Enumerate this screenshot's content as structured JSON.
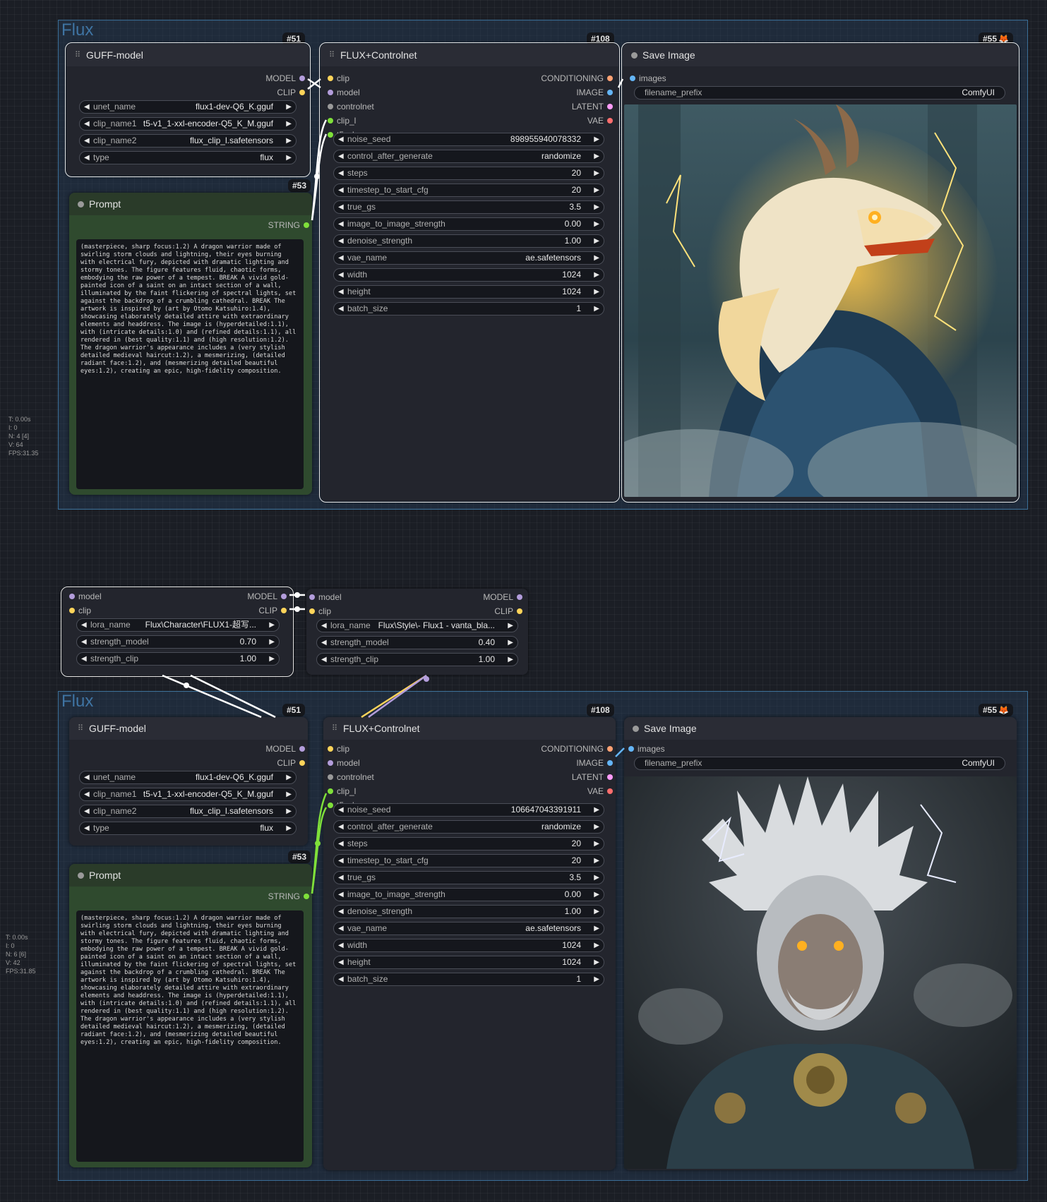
{
  "stats_top": [
    "T: 0.00s",
    "I: 0",
    "N: 4 [4]",
    "V: 64",
    "FPS:31.35"
  ],
  "stats_bottom": [
    "T: 0.00s",
    "I: 0",
    "N: 6 [6]",
    "V: 42",
    "FPS:31.85"
  ],
  "group_title": "Flux",
  "guff": {
    "badge": "#51",
    "title": "GUFF-model",
    "out_model": "MODEL",
    "out_clip": "CLIP",
    "widgets": [
      {
        "name": "unet_name",
        "value": "flux1-dev-Q6_K.gguf"
      },
      {
        "name": "clip_name1",
        "value": "t5-v1_1-xxl-encoder-Q5_K_M.gguf"
      },
      {
        "name": "clip_name2",
        "value": "flux_clip_l.safetensors"
      },
      {
        "name": "type",
        "value": "flux"
      }
    ]
  },
  "prompt": {
    "badge": "#53",
    "title": "Prompt",
    "out_string": "STRING",
    "text": "(masterpiece, sharp focus:1.2) A dragon warrior made of swirling storm clouds and lightning, their eyes burning with electrical fury, depicted with dramatic lighting and stormy tones. The figure features fluid, chaotic forms, embodying the raw power of a tempest. BREAK A vivid gold-painted icon of a saint on an intact section of a wall, illuminated by the faint flickering of spectral lights, set against the backdrop of a crumbling cathedral. BREAK The artwork is inspired by (art by Otomo Katsuhiro:1.4), showcasing elaborately detailed attire with extraordinary elements and headdress. The image is (hyperdetailed:1.1), with (intricate details:1.0) and (refined details:1.1), all rendered in (best quality:1.1) and (high resolution:1.2). The dragon warrior's appearance includes a (very stylish detailed medieval haircut:1.2), a mesmerizing, (detailed radiant face:1.2), and (mesmerizing detailed beautiful eyes:1.2), creating an epic, high-fidelity composition."
  },
  "flux": {
    "badge": "#108",
    "title": "FLUX+Controlnet",
    "inputs": [
      "clip",
      "model",
      "controlnet",
      "clip_l",
      "t5xxl"
    ],
    "outputs": [
      "CONDITIONING",
      "IMAGE",
      "LATENT",
      "VAE"
    ],
    "widgets_top": [
      {
        "name": "noise_seed",
        "value": "898955940078332"
      },
      {
        "name": "control_after_generate",
        "value": "randomize"
      },
      {
        "name": "steps",
        "value": "20"
      },
      {
        "name": "timestep_to_start_cfg",
        "value": "20"
      },
      {
        "name": "true_gs",
        "value": "3.5"
      },
      {
        "name": "image_to_image_strength",
        "value": "0.00"
      },
      {
        "name": "denoise_strength",
        "value": "1.00"
      },
      {
        "name": "vae_name",
        "value": "ae.safetensors"
      },
      {
        "name": "width",
        "value": "1024"
      },
      {
        "name": "height",
        "value": "1024"
      },
      {
        "name": "batch_size",
        "value": "1"
      }
    ],
    "seed_bottom": "106647043391911"
  },
  "save": {
    "badge": "#55",
    "title": "Save Image",
    "in_images": "images",
    "prefix_name": "filename_prefix",
    "prefix_value": "ComfyUI"
  },
  "lora1": {
    "in_model": "model",
    "in_clip": "clip",
    "out_model": "MODEL",
    "out_clip": "CLIP",
    "widgets": [
      {
        "name": "lora_name",
        "value": "Flux\\Character\\FLUX1-超写..."
      },
      {
        "name": "strength_model",
        "value": "0.70"
      },
      {
        "name": "strength_clip",
        "value": "1.00"
      }
    ]
  },
  "lora2": {
    "in_model": "model",
    "in_clip": "clip",
    "out_model": "MODEL",
    "out_clip": "CLIP",
    "widgets": [
      {
        "name": "lora_name",
        "value": "Flux\\Style\\- Flux1 - vanta_bla..."
      },
      {
        "name": "strength_model",
        "value": "0.40"
      },
      {
        "name": "strength_clip",
        "value": "1.00"
      }
    ]
  },
  "colors": {
    "group_border": "#3b6f98",
    "prompt_green": "#2f4a2e",
    "link_green": "#7fe03a"
  }
}
